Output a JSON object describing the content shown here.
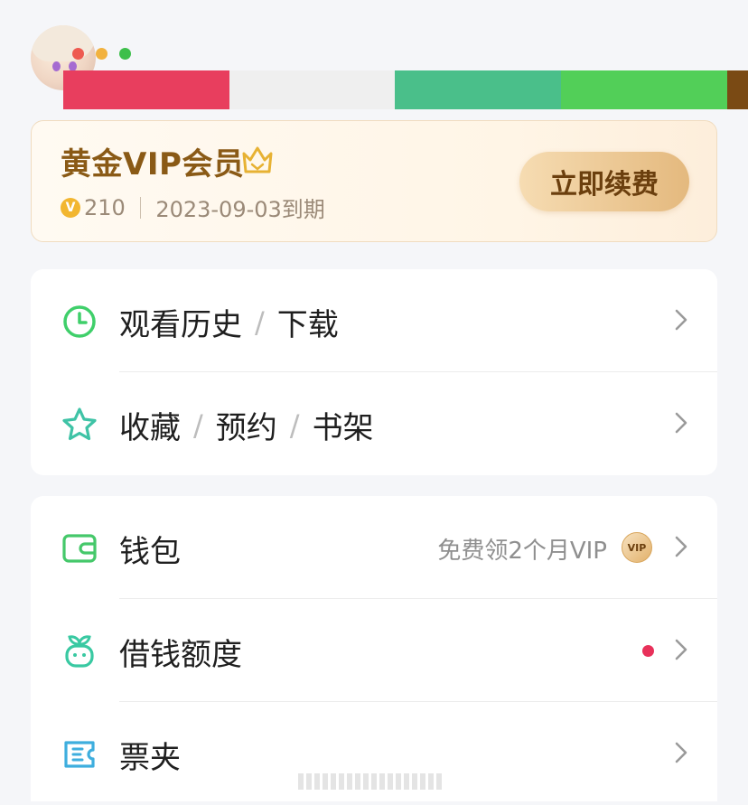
{
  "colors": {
    "strip": [
      "#e83e5e",
      "#efefef",
      "#4abf8a",
      "#52cf58",
      "#7a4a14"
    ],
    "window_dots": [
      "#ee5a50",
      "#f2b23f",
      "#3dbf4b"
    ],
    "vip_gold": "#8a5a16",
    "renew_btn": "#e4b97e",
    "clock_icon": "#3fcf6a",
    "star_icon": "#3fc3a6",
    "wallet_icon": "#45c86a",
    "seed_icon": "#39c9a2",
    "ticket_icon": "#3eaede",
    "notification_dot": "#e8315a"
  },
  "vip": {
    "title": "黄金VIP会员",
    "coin_symbol": "V",
    "points": "210",
    "expiry": "2023-09-03到期",
    "renew_label": "立即续费"
  },
  "menu_group1": [
    {
      "labels": [
        "观看历史",
        "下载"
      ],
      "icon": "clock-icon"
    },
    {
      "labels": [
        "收藏",
        "预约",
        "书架"
      ],
      "icon": "star-icon"
    }
  ],
  "menu_group2": [
    {
      "label": "钱包",
      "icon": "wallet-icon",
      "side_text": "免费领2个月VIP",
      "badge": "VIP"
    },
    {
      "label": "借钱额度",
      "icon": "seed-icon"
    },
    {
      "label": "票夹",
      "icon": "ticket-icon"
    }
  ]
}
